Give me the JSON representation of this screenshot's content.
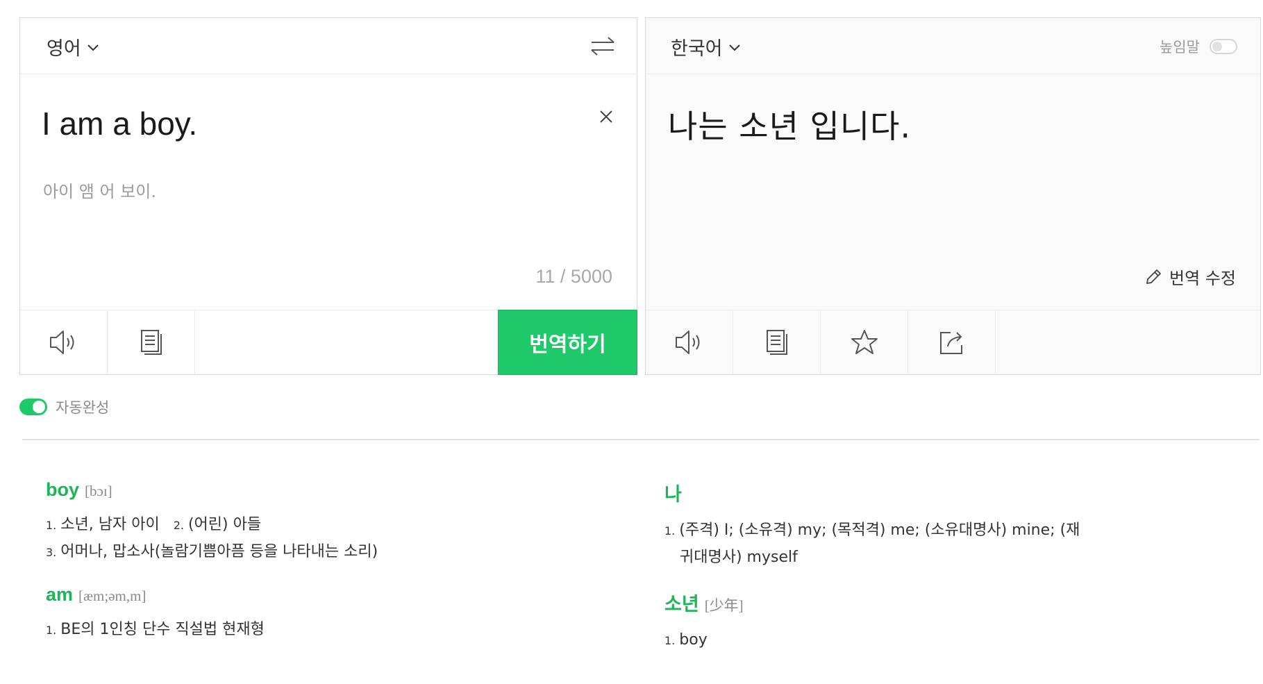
{
  "source": {
    "language": "영어",
    "text": "I am a boy.",
    "pronunciation": "아이 앰 어 보이.",
    "char_count": "11 / 5000",
    "translate_label": "번역하기"
  },
  "target": {
    "language": "한국어",
    "honorific_label": "높임말",
    "text": "나는 소년 입니다.",
    "edit_label": "번역 수정"
  },
  "autocomplete_label": "자동완성",
  "dictionary": {
    "left": [
      {
        "word": "boy",
        "phonetic": "[bɔɪ]",
        "lines": [
          [
            {
              "num": "1.",
              "text": "소년, 남자 아이"
            },
            {
              "num": "2.",
              "text": "(어린) 아들"
            }
          ],
          [
            {
              "num": "3.",
              "text": "어머나, 맙소사(놀람기쁨아픔 등을 나타내는 소리)"
            }
          ]
        ]
      },
      {
        "word": "am",
        "phonetic": "[æm;əm,m]",
        "lines": [
          [
            {
              "num": "1.",
              "text": "BE의 1인칭 단수 직설법 현재형"
            }
          ]
        ]
      }
    ],
    "right": [
      {
        "word": "나",
        "phonetic": "",
        "line1_num": "1.",
        "line1": "(주격) I; (소유격) my; (목적격) me; (소유대명사) mine; (재",
        "line2": "귀대명사) myself"
      },
      {
        "word": "소년",
        "phonetic": "[少年]",
        "line1_num": "1.",
        "line1": "boy"
      }
    ]
  },
  "colors": {
    "accent": "#1ec96a",
    "headword": "#1fb45a"
  }
}
